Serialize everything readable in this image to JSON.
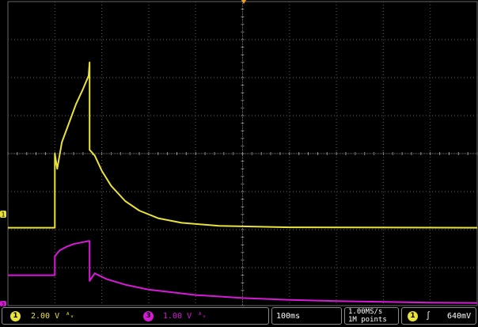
{
  "scope": {
    "divisions": {
      "x": 10,
      "y": 8
    },
    "colors": {
      "ch1": "#e8e23a",
      "ch3": "#d81ad8",
      "grid": "#5a5a5a",
      "background": "#000000",
      "trigger_marker": "#f0a020"
    },
    "ch1": {
      "marker": "1",
      "scale": "2.00 V",
      "coupling_icon": "bandwidth-limit-icon",
      "coupling_glyph": "ᴬᵥ"
    },
    "ch3": {
      "marker": "3",
      "scale": "1.00 V",
      "coupling_icon": "bandwidth-limit-icon",
      "coupling_glyph": "ᴬᵥ"
    },
    "timebase": {
      "scale": "100ms"
    },
    "acquisition": {
      "sample_rate": "1.00MS/s",
      "record_length": "1M points"
    },
    "trigger": {
      "source": "1",
      "slope_icon": "rising-edge-icon",
      "slope_glyph": "∫",
      "level": "640mV"
    }
  },
  "chart_data": {
    "type": "line",
    "x_divisions": 10,
    "y_divisions": 8,
    "series": [
      {
        "key": "ch1",
        "baseline_div": -1.95,
        "points": [
          [
            0,
            -1.95
          ],
          [
            0.95,
            -1.95
          ],
          [
            1.0,
            -1.95
          ],
          [
            1.0,
            0.0
          ],
          [
            1.05,
            -0.4
          ],
          [
            1.15,
            0.3
          ],
          [
            1.3,
            0.8
          ],
          [
            1.45,
            1.3
          ],
          [
            1.6,
            1.7
          ],
          [
            1.72,
            2.05
          ],
          [
            1.74,
            2.4
          ],
          [
            1.74,
            0.1
          ],
          [
            1.85,
            -0.05
          ],
          [
            2.0,
            -0.45
          ],
          [
            2.2,
            -0.85
          ],
          [
            2.5,
            -1.25
          ],
          [
            2.8,
            -1.5
          ],
          [
            3.2,
            -1.7
          ],
          [
            3.7,
            -1.82
          ],
          [
            4.5,
            -1.9
          ],
          [
            6.0,
            -1.94
          ],
          [
            10,
            -1.95
          ]
        ]
      },
      {
        "key": "ch3",
        "baseline_div": -3.2,
        "points": [
          [
            0,
            -3.2
          ],
          [
            0.95,
            -3.2
          ],
          [
            1.0,
            -3.2
          ],
          [
            1.0,
            -2.7
          ],
          [
            1.1,
            -2.55
          ],
          [
            1.25,
            -2.45
          ],
          [
            1.4,
            -2.38
          ],
          [
            1.6,
            -2.33
          ],
          [
            1.72,
            -2.3
          ],
          [
            1.74,
            -2.3
          ],
          [
            1.74,
            -3.35
          ],
          [
            1.85,
            -3.15
          ],
          [
            2.1,
            -3.3
          ],
          [
            2.5,
            -3.45
          ],
          [
            3.0,
            -3.58
          ],
          [
            4.0,
            -3.72
          ],
          [
            5.0,
            -3.8
          ],
          [
            6.0,
            -3.85
          ],
          [
            7.0,
            -3.88
          ],
          [
            8.0,
            -3.9
          ],
          [
            9.0,
            -3.92
          ],
          [
            10,
            -3.93
          ]
        ]
      }
    ]
  }
}
